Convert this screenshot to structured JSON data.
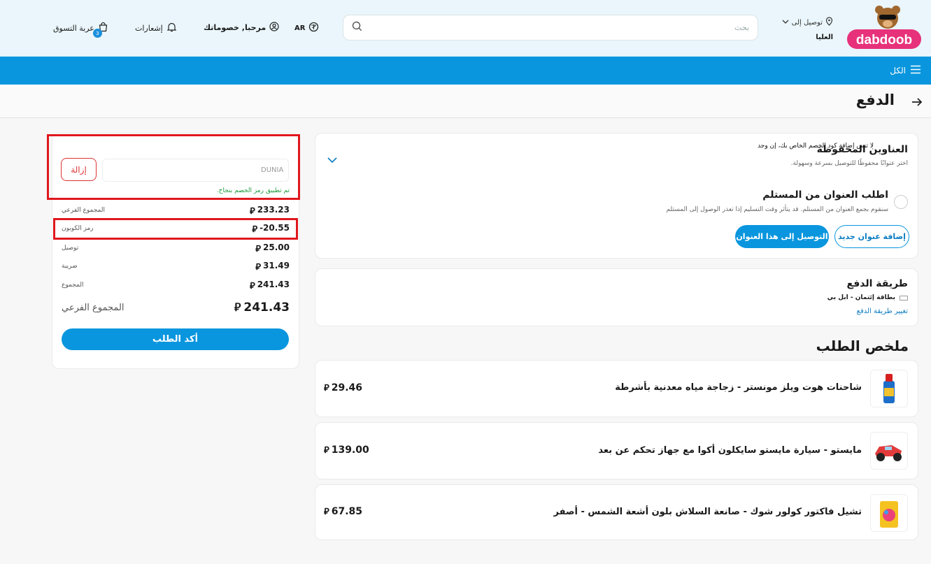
{
  "header": {
    "delivery_label": "توصيل إلى",
    "delivery_city": "العليا",
    "search_placeholder": "بحث",
    "language": "AR",
    "account_greeting": "مرحبا, خصوماتك",
    "notifications": "إشعارات",
    "cart": "عربة التسوق",
    "cart_count": "3"
  },
  "nav": {
    "all": "الكل"
  },
  "page": {
    "title": "الدفع"
  },
  "addresses": {
    "saved_title": "العناوين المحفوظة",
    "saved_sub": "اختر عنوانًا محفوظًا للتوصيل بسرعة وسهولة.",
    "request_title": "اطلب العنوان من المستلم",
    "request_sub": "سنقوم بجمع العنوان من المستلم. قد يتأثر وقت التسليم إذا تعذر الوصول إلى المستلم",
    "add_new": "إضافة عنوان جديد",
    "deliver_here": "التوصيل إلى هذا العنوان"
  },
  "payment": {
    "title": "طريقة الدفع",
    "method": "بطاقة إئتمان - ابل بي",
    "change": "تغيير طريقة الدفع"
  },
  "summary": {
    "title": "ملخص الطلب",
    "currency_symbol": "⃁",
    "items": [
      {
        "name": "شاحنات هوت ويلز مونستر - زجاجة مياه معدنية بأشرطة",
        "price": "29.46"
      },
      {
        "name": "مايستو - سيارة مايستو سايكلون أكوا مع جهاز تحكم عن بعد",
        "price": "139.00"
      },
      {
        "name": "تشيل فاكتور كولور شوك - صانعة السلاش بلون أشعة الشمس - أصفر",
        "price": "67.85"
      }
    ]
  },
  "coupon": {
    "note": "لا تنس إضافة كود الخصم الخاص بك، إن وجد",
    "code": "DUNIA",
    "remove": "إزالة",
    "success": "تم تطبيق رمز الخصم بنجاح."
  },
  "totals": {
    "rows": [
      {
        "label": "المجموع الفرعي",
        "value": "233.23"
      },
      {
        "label": "رمز الكوبون",
        "value": "-20.55"
      },
      {
        "label": "توصيل",
        "value": "25.00"
      },
      {
        "label": "ضريبة",
        "value": "31.49"
      },
      {
        "label": "المجموع",
        "value": "241.43"
      }
    ],
    "grand_label": "المجموع الفرعي",
    "grand_value": "241.43",
    "confirm": "أكد الطلب"
  }
}
